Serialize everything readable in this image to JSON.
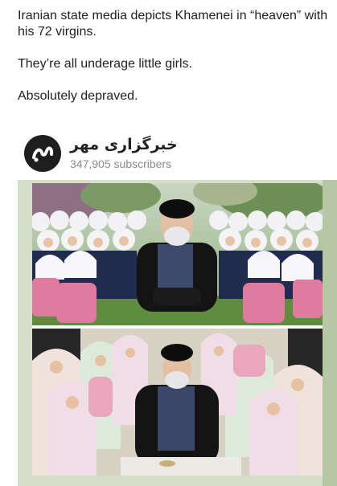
{
  "post": {
    "line1": "Iranian state media depicts Khamenei in “heaven” with",
    "line2": "his 72 virgins.",
    "line3": "They’re all underage little girls.",
    "line4": "Absolutely depraved."
  },
  "channel": {
    "name": "خبرگزاری مهر",
    "subscribers": "347,905 subscribers",
    "avatar_icon": "mehr-logo-icon"
  },
  "photos": {
    "top_caption": "",
    "bottom_caption": ""
  },
  "colors": {
    "card_background": "#d6dfc9",
    "avatar_background": "#1e1e1e",
    "subscriber_text": "#8a8a8a",
    "hijab_white": "#f2f2f5",
    "uniform_navy": "#1f2b4f",
    "backpack_pink": "#e07a9e"
  }
}
